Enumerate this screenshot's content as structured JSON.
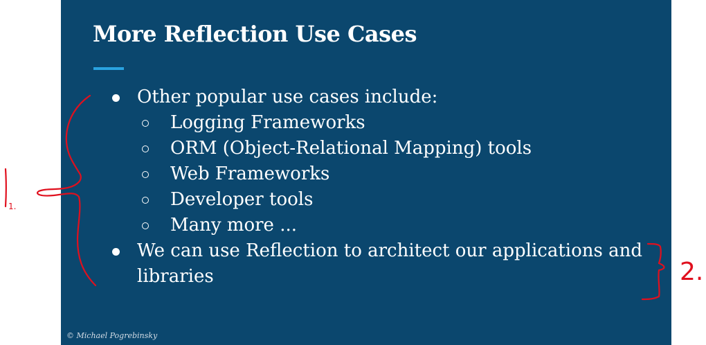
{
  "slide": {
    "title": "More Reflection Use Cases",
    "bullets": [
      {
        "text": "Other popular use cases include:",
        "sub_items": [
          "Logging Frameworks",
          "ORM (Object-Relational Mapping) tools",
          "Web Frameworks",
          "Developer tools",
          "Many more ..."
        ]
      },
      {
        "text": "We can use Reflection to architect our applications and libraries"
      }
    ],
    "footer": "© Michael Pogrebinsky"
  },
  "annotations": {
    "label_1": "1.",
    "label_2": "2.",
    "color": "#e0101e"
  },
  "colors": {
    "slide_background": "#0b476e",
    "title_rule": "#2aa3e0",
    "text": "#ffffff"
  }
}
